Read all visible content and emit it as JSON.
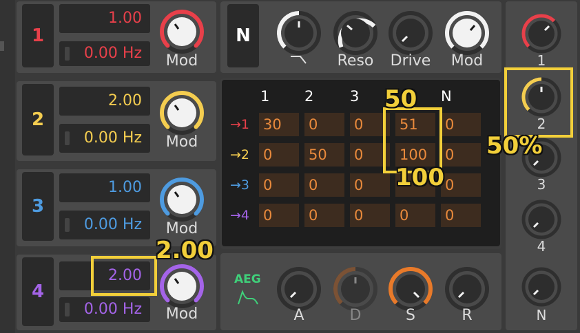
{
  "oscillators": [
    {
      "number": "1",
      "color": "#e8404a",
      "value": "1.00",
      "hz": "0.00 Hz",
      "mod_label": "Mod"
    },
    {
      "number": "2",
      "color": "#f4cd50",
      "value": "2.00",
      "hz": "0.00 Hz",
      "mod_label": "Mod"
    },
    {
      "number": "3",
      "color": "#4e9be0",
      "value": "1.00",
      "hz": "0.00 Hz",
      "mod_label": "Mod"
    },
    {
      "number": "4",
      "color": "#a464e8",
      "value": "2.00",
      "hz": "0.00 Hz",
      "mod_label": "Mod"
    }
  ],
  "filter": {
    "badge": "N",
    "knobs": [
      {
        "name": "cutoff-knob",
        "label": "",
        "icon": "lowpass-curve-icon"
      },
      {
        "name": "reso-knob",
        "label": "Reso"
      },
      {
        "name": "drive-knob",
        "label": "Drive"
      },
      {
        "name": "filter-mod-knob",
        "label": "Mod"
      }
    ]
  },
  "matrix": {
    "columns": [
      "1",
      "2",
      "3",
      "",
      "N"
    ],
    "rows": [
      {
        "label": "→1",
        "color": "#e8404a",
        "values": [
          "30",
          "0",
          "0",
          "51",
          "0"
        ]
      },
      {
        "label": "→2",
        "color": "#f4cd50",
        "values": [
          "0",
          "50",
          "0",
          "100",
          "0"
        ]
      },
      {
        "label": "→3",
        "color": "#4e9be0",
        "values": [
          "0",
          "0",
          "0",
          "",
          "0"
        ]
      },
      {
        "label": "→4",
        "color": "#a464e8",
        "values": [
          "0",
          "0",
          "0",
          "0",
          "0"
        ]
      }
    ]
  },
  "envelope": {
    "title": "AEG",
    "title_color": "#3fd07a",
    "icon": "envelope-shape-icon",
    "knobs": [
      {
        "label": "A"
      },
      {
        "label": "D"
      },
      {
        "label": "S"
      },
      {
        "label": "R"
      }
    ]
  },
  "output_levels": [
    {
      "label": "1"
    },
    {
      "label": "2"
    },
    {
      "label": "3"
    },
    {
      "label": "4"
    },
    {
      "label": "N"
    }
  ],
  "annotations": {
    "matrix_top": "50",
    "matrix_bottom": "100",
    "level": "50%",
    "value": "2.00"
  }
}
